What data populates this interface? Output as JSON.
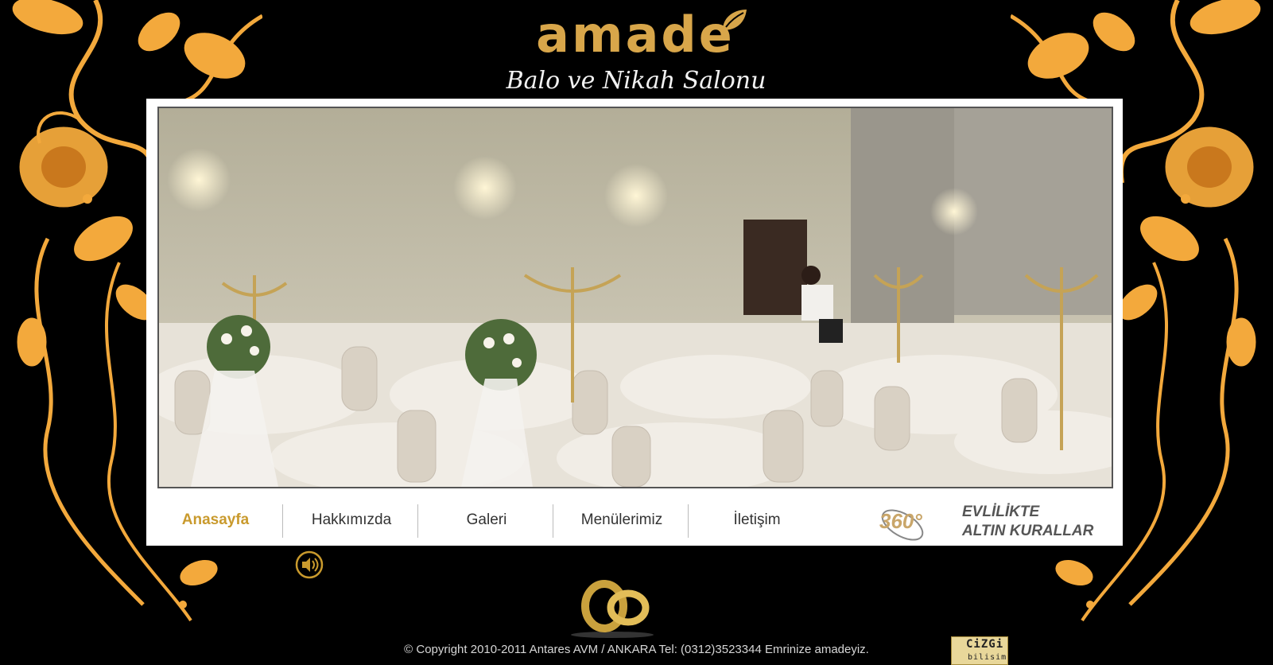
{
  "logo": {
    "brand": "amade",
    "subtitle": "Balo ve Nikah Salonu"
  },
  "nav": {
    "items": [
      {
        "label": "Anasayfa",
        "active": true
      },
      {
        "label": "Hakkımızda",
        "active": false
      },
      {
        "label": "Galeri",
        "active": false
      },
      {
        "label": "Menülerimiz",
        "active": false
      },
      {
        "label": "İletişim",
        "active": false
      }
    ],
    "badge_360": "360°",
    "golden_rules_line1": "EVLİLİKTE",
    "golden_rules_line2": "ALTIN KURALLAR"
  },
  "footer": {
    "copyright": "© Copyright 2010-2011 Antares AVM / ANKARA Tel: (0312)3523344  Emrinize amadeyiz."
  },
  "credit": {
    "top": "CiZGi",
    "bottom": "bilisim"
  },
  "icons": {
    "sound": "speaker-icon",
    "rings": "wedding-rings-icon",
    "ornament": "floral-ornament-icon"
  },
  "colors": {
    "accent": "#c99a2d",
    "ornament": "#f3a93c",
    "background": "#000000",
    "panel": "#ffffff"
  }
}
